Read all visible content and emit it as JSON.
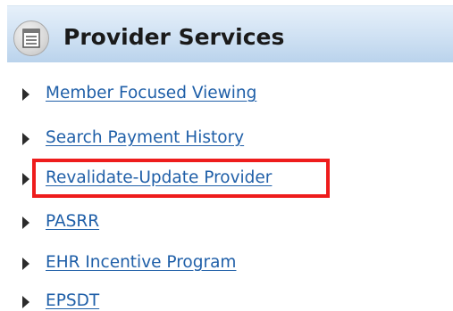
{
  "header": {
    "title": "Provider Services",
    "icon": "document-list-icon"
  },
  "links": [
    {
      "label": "Member Focused Viewing",
      "highlighted": false
    },
    {
      "label": "Search Payment History",
      "highlighted": false
    },
    {
      "label": "Revalidate-Update Provider",
      "highlighted": true
    },
    {
      "label": "PASRR",
      "highlighted": false
    },
    {
      "label": "EHR Incentive Program",
      "highlighted": false
    },
    {
      "label": "EPSDT",
      "highlighted": false
    }
  ],
  "colors": {
    "link": "#1f5fa8",
    "highlight": "#ee1c1c",
    "header_bg": "#cfe1f3"
  }
}
